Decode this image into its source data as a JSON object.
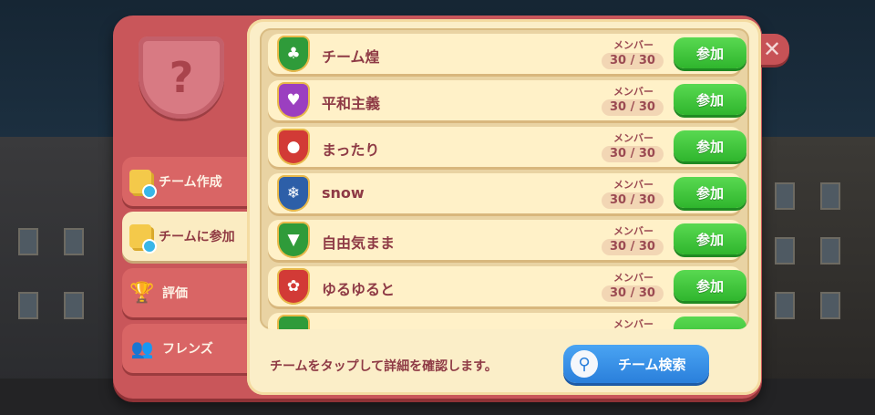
{
  "side_tabs": [
    {
      "label": "チーム作成",
      "icon": "docs-icon"
    },
    {
      "label": "チームに参加",
      "icon": "docs-icon",
      "active": true
    },
    {
      "label": "評価",
      "icon": "trophy-icon"
    },
    {
      "label": "フレンズ",
      "icon": "friends-icon"
    }
  ],
  "teams": [
    {
      "name": "チーム煌",
      "member_label": "メンバー",
      "count": "30 / 30",
      "join_label": "参加",
      "badge_icon": "tree-icon",
      "badge_color": "#2f9b3a",
      "glyph": "♣"
    },
    {
      "name": "平和主義",
      "member_label": "メンバー",
      "count": "30 / 30",
      "join_label": "参加",
      "badge_icon": "heart-icon",
      "badge_color": "#9b3fc0",
      "glyph": "♥"
    },
    {
      "name": "まったり",
      "member_label": "メンバー",
      "count": "30 / 30",
      "join_label": "参加",
      "badge_icon": "apple-icon",
      "badge_color": "#d23a36",
      "glyph": "●"
    },
    {
      "name": "snow",
      "member_label": "メンバー",
      "count": "30 / 30",
      "join_label": "参加",
      "badge_icon": "snowflake-icon",
      "badge_color": "#2d5fa8",
      "glyph": "❄"
    },
    {
      "name": "自由気まま",
      "member_label": "メンバー",
      "count": "30 / 30",
      "join_label": "参加",
      "badge_icon": "cat-icon",
      "badge_color": "#2f9b3a",
      "glyph": "▼"
    },
    {
      "name": "ゆるゆると",
      "member_label": "メンバー",
      "count": "30 / 30",
      "join_label": "参加",
      "badge_icon": "ribbon-icon",
      "badge_color": "#d23a36",
      "glyph": "✿"
    },
    {
      "name": "",
      "member_label": "メンバー",
      "count": "",
      "join_label": "",
      "badge_icon": "cat-icon",
      "badge_color": "#2f9b3a",
      "glyph": ""
    }
  ],
  "footer": {
    "hint": "チームをタップして詳細を確認します。",
    "search_label": "チーム検索"
  },
  "emblem_glyph": "?",
  "close_glyph": "✕"
}
